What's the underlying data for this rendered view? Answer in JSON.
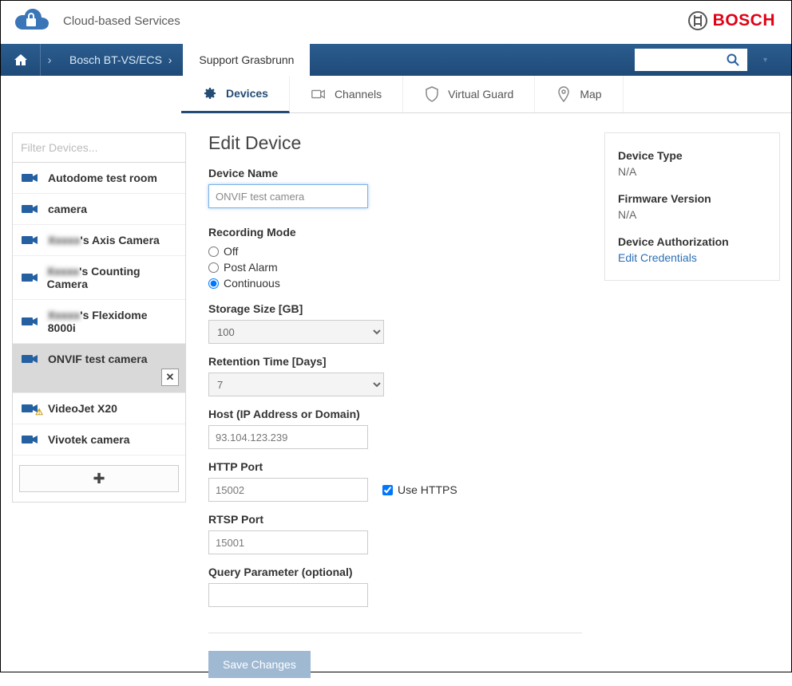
{
  "app": {
    "title": "Cloud-based Services"
  },
  "brand": {
    "name": "BOSCH"
  },
  "breadcrumb": {
    "items": [
      "Bosch BT-VS/ECS",
      "Support Grasbrunn"
    ]
  },
  "search": {
    "placeholder": ""
  },
  "tabs": [
    {
      "id": "devices",
      "label": "Devices",
      "active": true
    },
    {
      "id": "channels",
      "label": "Channels",
      "active": false
    },
    {
      "id": "virtualguard",
      "label": "Virtual Guard",
      "active": false
    },
    {
      "id": "map",
      "label": "Map",
      "active": false
    }
  ],
  "sidebar": {
    "filter_placeholder": "Filter Devices...",
    "items": [
      {
        "label": "Autodome test room",
        "selected": false,
        "warn": false,
        "blur": false
      },
      {
        "label": "camera",
        "selected": false,
        "warn": false,
        "blur": false
      },
      {
        "label": "'s Axis Camera",
        "selected": false,
        "warn": false,
        "blur": true
      },
      {
        "label": "'s Counting Camera",
        "selected": false,
        "warn": false,
        "blur": true
      },
      {
        "label": "'s Flexidome 8000i",
        "selected": false,
        "warn": false,
        "blur": true
      },
      {
        "label": "ONVIF test camera",
        "selected": true,
        "warn": false,
        "blur": false
      },
      {
        "label": "VideoJet X20",
        "selected": false,
        "warn": true,
        "blur": false
      },
      {
        "label": "Vivotek camera",
        "selected": false,
        "warn": false,
        "blur": false
      }
    ]
  },
  "form": {
    "title": "Edit Device",
    "labels": {
      "device_name": "Device Name",
      "recording_mode": "Recording Mode",
      "storage_size": "Storage Size [GB]",
      "retention": "Retention Time [Days]",
      "host": "Host (IP Address or Domain)",
      "http_port": "HTTP Port",
      "use_https": "Use HTTPS",
      "rtsp_port": "RTSP Port",
      "query_param": "Query Parameter (optional)"
    },
    "values": {
      "device_name": "ONVIF test camera",
      "storage_size": "100",
      "retention": "7",
      "host": "93.104.123.239",
      "http_port": "15002",
      "rtsp_port": "15001",
      "query_param": "",
      "use_https": true
    },
    "recording_options": [
      {
        "label": "Off",
        "checked": false
      },
      {
        "label": "Post Alarm",
        "checked": false
      },
      {
        "label": "Continuous",
        "checked": true
      }
    ],
    "save_label": "Save Changes"
  },
  "info": {
    "device_type_label": "Device Type",
    "device_type_value": "N/A",
    "firmware_label": "Firmware Version",
    "firmware_value": "N/A",
    "auth_label": "Device Authorization",
    "auth_link": "Edit Credentials"
  }
}
